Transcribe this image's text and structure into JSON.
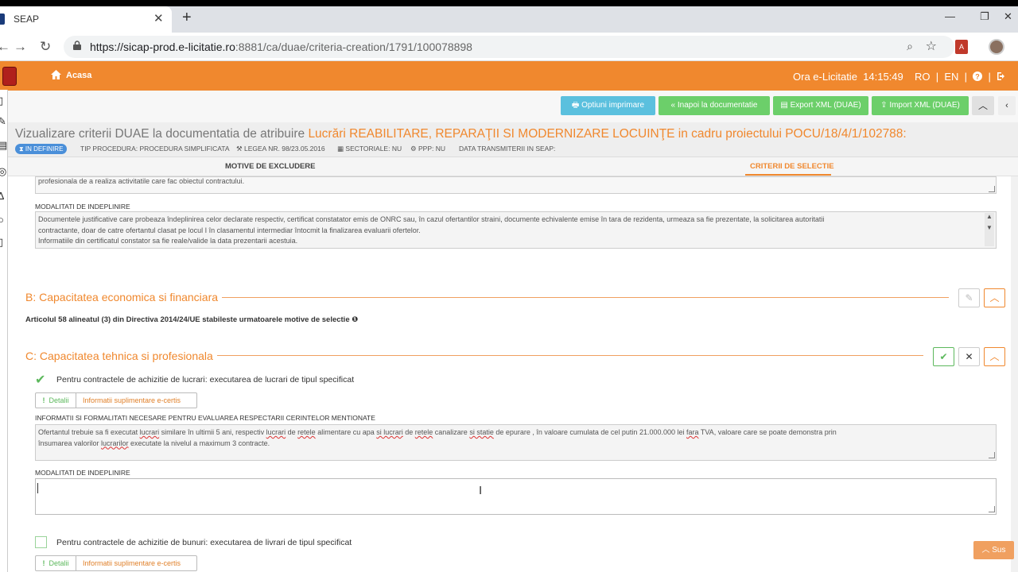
{
  "browser": {
    "tab_title": "SEAP",
    "tab_close": "✕",
    "new_tab": "+",
    "url_main": "https://sicap-prod.e-licitatie.ro",
    "url_rest": ":8881/ca/duae/criteria-creation/1791/100078898",
    "win_min": "—",
    "win_restore": "❐",
    "win_close": "✕",
    "back": "←",
    "forward": "→",
    "reload": "↻",
    "zoom_icon": "⌕",
    "star_icon": "☆",
    "pdf_ext": "A"
  },
  "header": {
    "home_label": "Acasa",
    "clock_label": "Ora e-Licitatie",
    "clock_time": "14:15:49",
    "lang_ro": "RO",
    "lang_en": "EN",
    "sep": "|",
    "accent": "#f0882e"
  },
  "actions": {
    "print": "Optiuni imprimare",
    "back_doc": "Inapoi la documentatie",
    "export": "Export XML (DUAE)",
    "import": "Import XML (DUAE)"
  },
  "page": {
    "title_prefix": "Vizualizare criterii DUAE la documentatia de atribuire ",
    "title_highlight": "Lucrări REABILITARE, REPARAŢII SI MODERNIZARE LOCUINŢE in cadru proiectului POCU/18/4/1/102788:",
    "status": "IN DEFINIRE",
    "tip_procedura": "TIP PROCEDURA: PROCEDURA SIMPLIFICATA",
    "legea": "LEGEA NR. 98/23.05.2016",
    "sectoriale": "SECTORIALE: NU",
    "ppp": "PPP: NU",
    "data_transmiterii": "DATA TRANSMITERII IN SEAP:"
  },
  "tabs": {
    "excludere": "MOTIVE DE EXCLUDERE",
    "selectie": "CRITERII DE SELECTIE"
  },
  "content": {
    "top_partial": "profesionala de a realiza activitatile care fac obiectul contractului.",
    "modalitati_label": "MODALITATI DE INDEPLINIRE",
    "modalitati_text_1": "Documentele justificative care probeaza îndeplinirea celor declarate respectiv, certificat constatator emis de ONRC sau, în cazul ofertantilor straini, documente echivalente emise în tara de rezidenta, urmeaza sa fie prezentate, la solicitarea autoritatii",
    "modalitati_text_2": "contractante, doar de catre ofertantul clasat pe locul I în clasamentul intermediar întocmit la finalizarea evaluarii ofertelor.",
    "modalitati_text_3": "Informatiile din certificatul constator sa fie reale/valide la data prezentarii acestuia.",
    "section_b": "B: Capacitatea economica si financiara",
    "articol": "Articolul 58 alineatul (3) din Directiva 2014/24/UE stabileste urmatoarele motive de selectie",
    "section_c": "C: Capacitatea tehnica si profesionala",
    "criteriu_lucrari": "Pentru contractele de achizitie de lucrari: executarea de lucrari de tipul specificat",
    "btn_detalii": "Detalii",
    "btn_info": "Informatii suplimentare e-certis",
    "info_label": "INFORMATII SI FORMALITATI NECESARE PENTRU EVALUAREA RESPECTARII CERINTELOR MENTIONATE",
    "info_text_a": "Ofertantul trebuie sa fi executat ",
    "info_w1": "lucrari",
    "info_text_b": " similare în ultimii 5 ani, respectiv ",
    "info_w2": "lucrari",
    "info_text_c": " de ",
    "info_w3": "retele",
    "info_text_d": " alimentare cu apa ",
    "info_w4": "si lucrari",
    "info_text_e": " de ",
    "info_w5": "retele",
    "info_text_f": " canalizare ",
    "info_w6": "si statie",
    "info_text_g": " de epurare , în valoare cumulata de cel putin 21.000.000 lei ",
    "info_w7": "fara",
    "info_text_h": " TVA, valoare care se poate demonstra prin",
    "info_line2_a": "însumarea valorilor ",
    "info_w8": "lucrarilor",
    "info_line2_b": " executate la nivelul a maximum 3 contracte.",
    "modalitati_label_2": "MODALITATI DE INDEPLINIRE",
    "criteriu_bunuri": "Pentru contractele de achizitie de bunuri: executarea de livrari de tipul specificat",
    "btn_detalii_2": "Detalii",
    "btn_info_2": "Informatii suplimentare e-certis",
    "sus": "Sus"
  }
}
